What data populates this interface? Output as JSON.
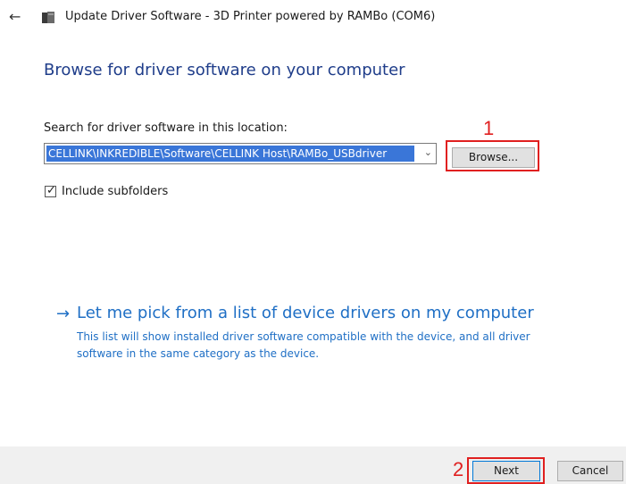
{
  "window": {
    "title": "Update Driver Software - 3D Printer powered by RAMBo (COM6)",
    "back_icon": "back-arrow-icon",
    "device_icon": "driver-package-icon"
  },
  "main": {
    "heading": "Browse for driver software on your computer",
    "search_label": "Search for driver software in this location:",
    "path_value": "CELLINK\\INKREDIBLE\\Software\\CELLINK Host\\RAMBo_USBdriver",
    "browse_label": "Browse...",
    "include_subfolders_label": "Include subfolders",
    "include_subfolders_checked": true,
    "pick_link": "Let me pick from a list of device drivers on my computer",
    "pick_description": "This list will show installed driver software compatible with the device, and all driver software in the same category as the device."
  },
  "annotations": {
    "marker_1": "1",
    "marker_2": "2",
    "highlight_color": "#e02020"
  },
  "footer": {
    "next_label": "Next",
    "cancel_label": "Cancel"
  },
  "colors": {
    "heading": "#1f3d8a",
    "link": "#1f6fc5",
    "selection": "#3a76d8"
  }
}
